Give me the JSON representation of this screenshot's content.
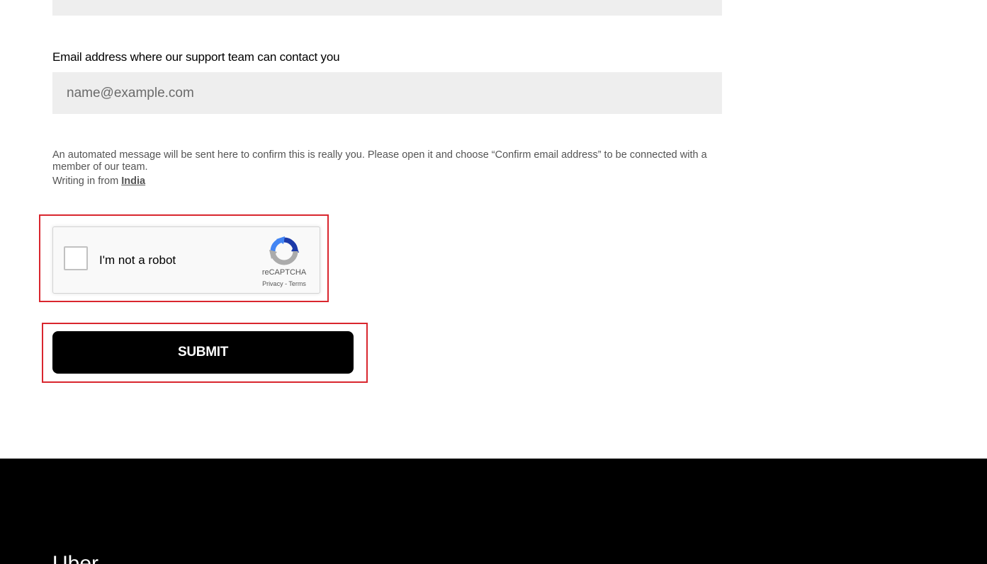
{
  "form": {
    "email": {
      "label": "Email address where our support team can contact you",
      "placeholder": "name@example.com",
      "value": ""
    },
    "helper_text": "An automated message will be sent here to confirm this is really you. Please open it and choose “Confirm email address” to be connected with a member of our team.",
    "writing_from_prefix": "Writing in from",
    "writing_from_country": "India",
    "captcha": {
      "label": "I'm not a robot",
      "brand": "reCAPTCHA",
      "privacy": "Privacy",
      "separator": " - ",
      "terms": "Terms"
    },
    "submit_label": "SUBMIT"
  },
  "footer": {
    "brand": "Uber"
  },
  "colors": {
    "highlight": "#d9262e",
    "input_bg": "#eeeeee",
    "button_bg": "#000000",
    "footer_bg": "#000000"
  },
  "icons": {
    "captcha_logo": "recaptcha-logo-icon"
  }
}
